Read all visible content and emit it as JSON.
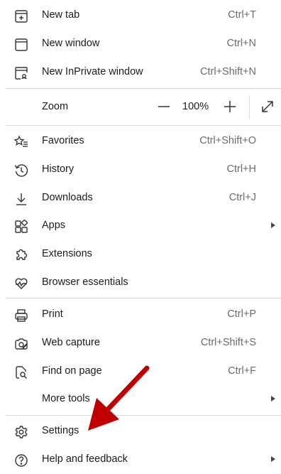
{
  "menu": {
    "new_tab": {
      "label": "New tab",
      "shortcut": "Ctrl+T",
      "icon": "new-tab-icon"
    },
    "new_window": {
      "label": "New window",
      "shortcut": "Ctrl+N",
      "icon": "window-icon"
    },
    "new_inprivate": {
      "label": "New InPrivate window",
      "shortcut": "Ctrl+Shift+N",
      "icon": "inprivate-icon"
    },
    "zoom": {
      "label": "Zoom",
      "value": "100%",
      "icons": [
        "minus-icon",
        "plus-icon",
        "expand-icon"
      ]
    },
    "favorites": {
      "label": "Favorites",
      "shortcut": "Ctrl+Shift+O",
      "icon": "star-list-icon"
    },
    "history": {
      "label": "History",
      "shortcut": "Ctrl+H",
      "icon": "history-icon"
    },
    "downloads": {
      "label": "Downloads",
      "shortcut": "Ctrl+J",
      "icon": "download-icon"
    },
    "apps": {
      "label": "Apps",
      "icon": "apps-icon"
    },
    "extensions": {
      "label": "Extensions",
      "icon": "puzzle-icon"
    },
    "browser_essentials": {
      "label": "Browser essentials",
      "icon": "heart-pulse-icon"
    },
    "print": {
      "label": "Print",
      "shortcut": "Ctrl+P",
      "icon": "printer-icon"
    },
    "web_capture": {
      "label": "Web capture",
      "shortcut": "Ctrl+Shift+S",
      "icon": "web-capture-icon"
    },
    "find_on_page": {
      "label": "Find on page",
      "shortcut": "Ctrl+F",
      "icon": "find-icon"
    },
    "more_tools": {
      "label": "More tools"
    },
    "settings": {
      "label": "Settings",
      "icon": "gear-icon"
    },
    "help": {
      "label": "Help and feedback",
      "icon": "help-icon"
    }
  },
  "annotation": {
    "color": "#c00000"
  }
}
